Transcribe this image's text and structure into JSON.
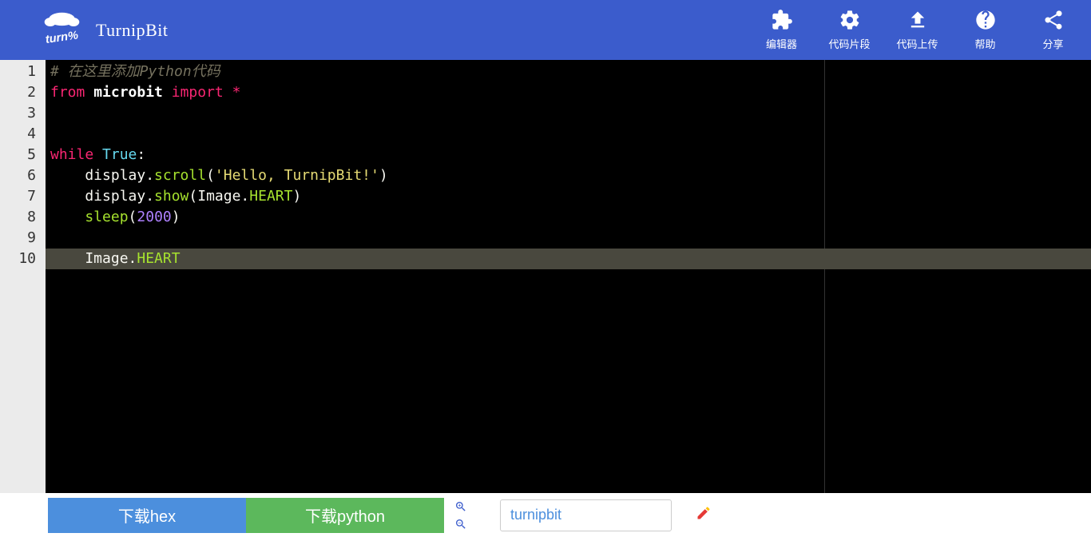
{
  "brand": "TurnipBit",
  "nav": [
    {
      "id": "editor",
      "label": "编辑器",
      "icon": "puzzle"
    },
    {
      "id": "snippet",
      "label": "代码片段",
      "icon": "gears"
    },
    {
      "id": "upload",
      "label": "代码上传",
      "icon": "upload"
    },
    {
      "id": "help",
      "label": "帮助",
      "icon": "question"
    },
    {
      "id": "share",
      "label": "分享",
      "icon": "share"
    }
  ],
  "editor": {
    "line_count": 10,
    "highlighted_line": 10,
    "lines": [
      {
        "tokens": [
          {
            "c": "cm-comment",
            "t": "# 在这里添加Python代码"
          }
        ]
      },
      {
        "tokens": [
          {
            "c": "cm-keyword",
            "t": "from"
          },
          {
            "c": "",
            "t": " "
          },
          {
            "c": "cm-def",
            "t": "microbit"
          },
          {
            "c": "",
            "t": " "
          },
          {
            "c": "cm-keyword",
            "t": "import"
          },
          {
            "c": "",
            "t": " "
          },
          {
            "c": "cm-operator",
            "t": "*"
          }
        ]
      },
      {
        "tokens": []
      },
      {
        "tokens": []
      },
      {
        "tokens": [
          {
            "c": "cm-keyword",
            "t": "while"
          },
          {
            "c": "",
            "t": " "
          },
          {
            "c": "cm-builtin",
            "t": "True"
          },
          {
            "c": "",
            "t": ":"
          }
        ]
      },
      {
        "tokens": [
          {
            "c": "",
            "t": "    display."
          },
          {
            "c": "cm-property",
            "t": "scroll"
          },
          {
            "c": "",
            "t": "("
          },
          {
            "c": "cm-string",
            "t": "'Hello, TurnipBit!'"
          },
          {
            "c": "",
            "t": ")"
          }
        ]
      },
      {
        "tokens": [
          {
            "c": "",
            "t": "    display."
          },
          {
            "c": "cm-property",
            "t": "show"
          },
          {
            "c": "",
            "t": "(Image."
          },
          {
            "c": "cm-property",
            "t": "HEART"
          },
          {
            "c": "",
            "t": ")"
          }
        ]
      },
      {
        "tokens": [
          {
            "c": "",
            "t": "    "
          },
          {
            "c": "cm-property",
            "t": "sleep"
          },
          {
            "c": "",
            "t": "("
          },
          {
            "c": "cm-number",
            "t": "2000"
          },
          {
            "c": "",
            "t": ")"
          }
        ]
      },
      {
        "tokens": []
      },
      {
        "tokens": [
          {
            "c": "",
            "t": "    Image."
          },
          {
            "c": "cm-property",
            "t": "HEART"
          }
        ]
      }
    ]
  },
  "footer": {
    "download_hex": "下载hex",
    "download_python": "下载python",
    "filename": "turnipbit"
  }
}
